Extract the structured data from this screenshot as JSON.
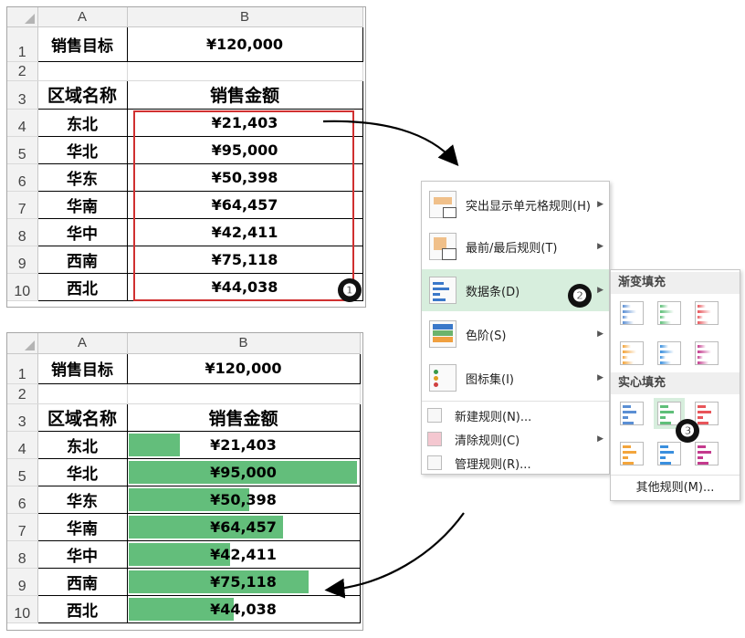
{
  "columns": {
    "a": "A",
    "b": "B"
  },
  "rows": [
    "1",
    "2",
    "3",
    "4",
    "5",
    "6",
    "7",
    "8",
    "9",
    "10"
  ],
  "target": {
    "label": "销售目标",
    "value": "¥120,000"
  },
  "headers": {
    "region": "区域名称",
    "amount": "销售金额"
  },
  "data": [
    {
      "region": "东北",
      "amount": "¥21,403",
      "value": 21403
    },
    {
      "region": "华北",
      "amount": "¥95,000",
      "value": 95000
    },
    {
      "region": "华东",
      "amount": "¥50,398",
      "value": 50398
    },
    {
      "region": "华南",
      "amount": "¥64,457",
      "value": 64457
    },
    {
      "region": "华中",
      "amount": "¥42,411",
      "value": 42411
    },
    {
      "region": "西南",
      "amount": "¥75,118",
      "value": 75118
    },
    {
      "region": "西北",
      "amount": "¥44,038",
      "value": 44038
    }
  ],
  "bar_color": "#63be7b",
  "menu": {
    "items": [
      {
        "label": "突出显示单元格规则(H)",
        "icon": "highlight-rules-icon"
      },
      {
        "label": "最前/最后规则(T)",
        "icon": "top-bottom-rules-icon"
      },
      {
        "label": "数据条(D)",
        "icon": "data-bars-icon"
      },
      {
        "label": "色阶(S)",
        "icon": "color-scales-icon"
      },
      {
        "label": "图标集(I)",
        "icon": "icon-sets-icon"
      }
    ],
    "small_items": [
      {
        "label": "新建规则(N)..."
      },
      {
        "label": "清除规则(C)"
      },
      {
        "label": "管理规则(R)..."
      }
    ]
  },
  "submenu": {
    "gradient_header": "渐变填充",
    "solid_header": "实心填充",
    "more": "其他规则(M)...",
    "colors": [
      "#5b8fd4",
      "#5fbf79",
      "#e8555a",
      "#f3a53c",
      "#3a8fde",
      "#c43a8d"
    ]
  },
  "badges": [
    "❶",
    "❷",
    "❸"
  ]
}
